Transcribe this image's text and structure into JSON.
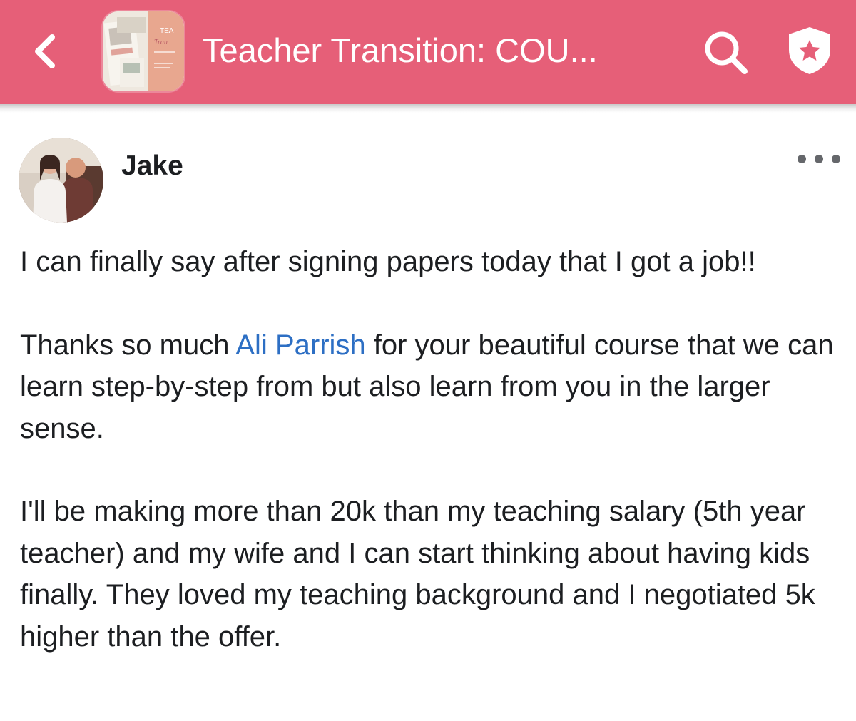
{
  "header": {
    "title": "Teacher Transition: COU...",
    "thumbnail_text": "TEA",
    "background_color": "#e65f78",
    "icons": {
      "back": "chevron-left-icon",
      "search": "search-icon",
      "badge": "shield-star-icon"
    }
  },
  "post": {
    "author": "Jake",
    "more_icon": "more-horizontal-icon",
    "paragraph1": "I can finally say after signing papers today that I got a job!!",
    "paragraph2": {
      "before": "Thanks so much ",
      "mention": "Ali Parrish",
      "after": " for your beautiful course that we can learn step-by-step from but also learn from you in the larger sense."
    },
    "paragraph3": "I'll be making more than 20k than my teaching salary (5th year teacher) and my wife and I can start thinking about having kids finally. They loved my teaching background and I negotiated 5k higher than the offer.",
    "mention_color": "#2d6fc4"
  }
}
